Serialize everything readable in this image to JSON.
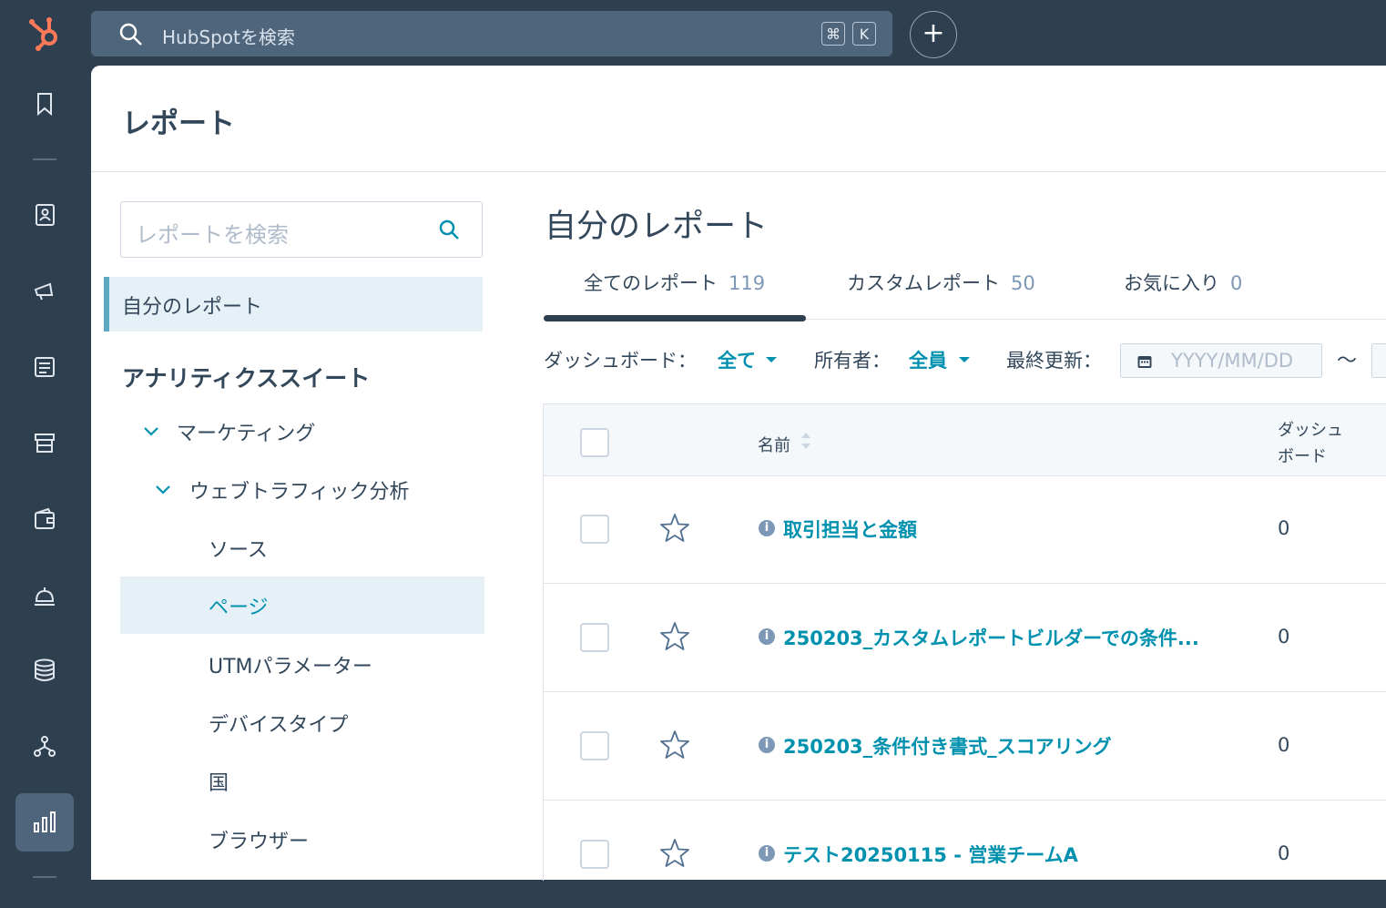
{
  "topbar": {
    "search_placeholder": "HubSpotを検索",
    "shortcut_cmd": "⌘",
    "shortcut_key": "K",
    "add_label": "+"
  },
  "header": {
    "title": "レポート"
  },
  "sidebar": {
    "search_placeholder": "レポートを検索",
    "my_reports": "自分のレポート",
    "section_heading": "アナリティクススイート",
    "marketing": "マーケティング",
    "web_traffic": "ウェブトラフィック分析",
    "items": [
      "ソース",
      "ページ",
      "UTMパラメーター",
      "デバイスタイプ",
      "国",
      "ブラウザー"
    ]
  },
  "main": {
    "title": "自分のレポート",
    "tabs": [
      {
        "label": "全てのレポート",
        "count": "119"
      },
      {
        "label": "カスタムレポート",
        "count": "50"
      },
      {
        "label": "お気に入り",
        "count": "0"
      }
    ],
    "filters": {
      "dashboard_label": "ダッシュボード：",
      "dashboard_value": "全て",
      "owner_label": "所有者：",
      "owner_value": "全員",
      "updated_label": "最終更新：",
      "date_placeholder": "YYYY/MM/DD",
      "tilde": "〜"
    },
    "table": {
      "col_name": "名前",
      "col_dashboard_1": "ダッシュ",
      "col_dashboard_2": "ボード",
      "rows": [
        {
          "name": "取引担当と金額",
          "dashboards": "0"
        },
        {
          "name": "250203_カスタムレポートビルダーでの条件...",
          "dashboards": "0"
        },
        {
          "name": "250203_条件付き書式_スコアリング",
          "dashboards": "0"
        },
        {
          "name": "テスト20250115 - 営業チームA",
          "dashboards": "0"
        }
      ]
    }
  },
  "colors": {
    "accent": "#0091ae",
    "nav_bg": "#2e3f50",
    "brand": "#ff7a59"
  }
}
